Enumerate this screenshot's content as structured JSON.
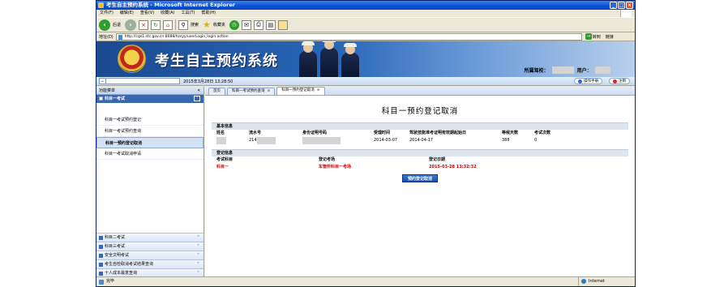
{
  "window": {
    "title": "考生自主预约系统 - Microsoft Internet Explorer",
    "controls": [
      "_",
      "□",
      "×"
    ]
  },
  "menu": [
    "文件(F)",
    "编辑(E)",
    "查看(V)",
    "收藏(A)",
    "工具(T)",
    "帮助(H)"
  ],
  "toolbar": {
    "back_label": "后退",
    "search_label": "搜索",
    "favorites_label": "收藏夹"
  },
  "address": {
    "label": "地址(D)",
    "url": "http://cgs1.stc.gov.cn:8088/hzsyy/userLogin_login.action",
    "go_label": "转到",
    "links_label": "链接"
  },
  "banner": {
    "title": "考生自主预约系统",
    "station_label": "所属驾校：",
    "user_label": "用户："
  },
  "subbar": {
    "datetime": "2015年3月28日 13:28:50",
    "help_label": "操作手册",
    "exit_label": "注销"
  },
  "sidebar": {
    "menu_title": "功能菜单",
    "collapse_glyph": "«",
    "section": "科目一考试",
    "items": [
      {
        "label": "科目一考试预约登记",
        "active": false
      },
      {
        "label": "科目一考试预约查询",
        "active": false
      },
      {
        "label": "科目一预约登记取消",
        "active": true
      },
      {
        "label": "科目一考试取消申请",
        "active": false
      }
    ],
    "folds": [
      "科目二考试",
      "科目三考试",
      "安全文明考试",
      "考生自检取消考试结果查询",
      "十人成本最意查询"
    ]
  },
  "tabs": [
    {
      "label": "首页",
      "closable": false,
      "active": false
    },
    {
      "label": "科目一考试预约查询",
      "closable": true,
      "active": false
    },
    {
      "label": "科目一预约登记取消",
      "closable": true,
      "active": true
    }
  ],
  "form": {
    "title": "科目一预约登记取消",
    "basic": {
      "heading": "基本信息",
      "headers": [
        "姓名",
        "流水号",
        "身份证明号码",
        "受理时间",
        "驾驶技能准考证明有效期起始日",
        "等候天数",
        "考试次数"
      ],
      "values": [
        "",
        "214",
        "",
        "2014-03-07",
        "2014-04-17",
        "388",
        "0"
      ]
    },
    "register": {
      "heading": "登记信息",
      "headers": [
        "考试科目",
        "登记考场",
        "登记日期"
      ],
      "values": [
        "科目一",
        "车管所科目一考场",
        "2015-03-28 13:32:32"
      ]
    },
    "action_label": "预约登记取消"
  },
  "status": {
    "left": "完毕",
    "zone": "Internet"
  }
}
